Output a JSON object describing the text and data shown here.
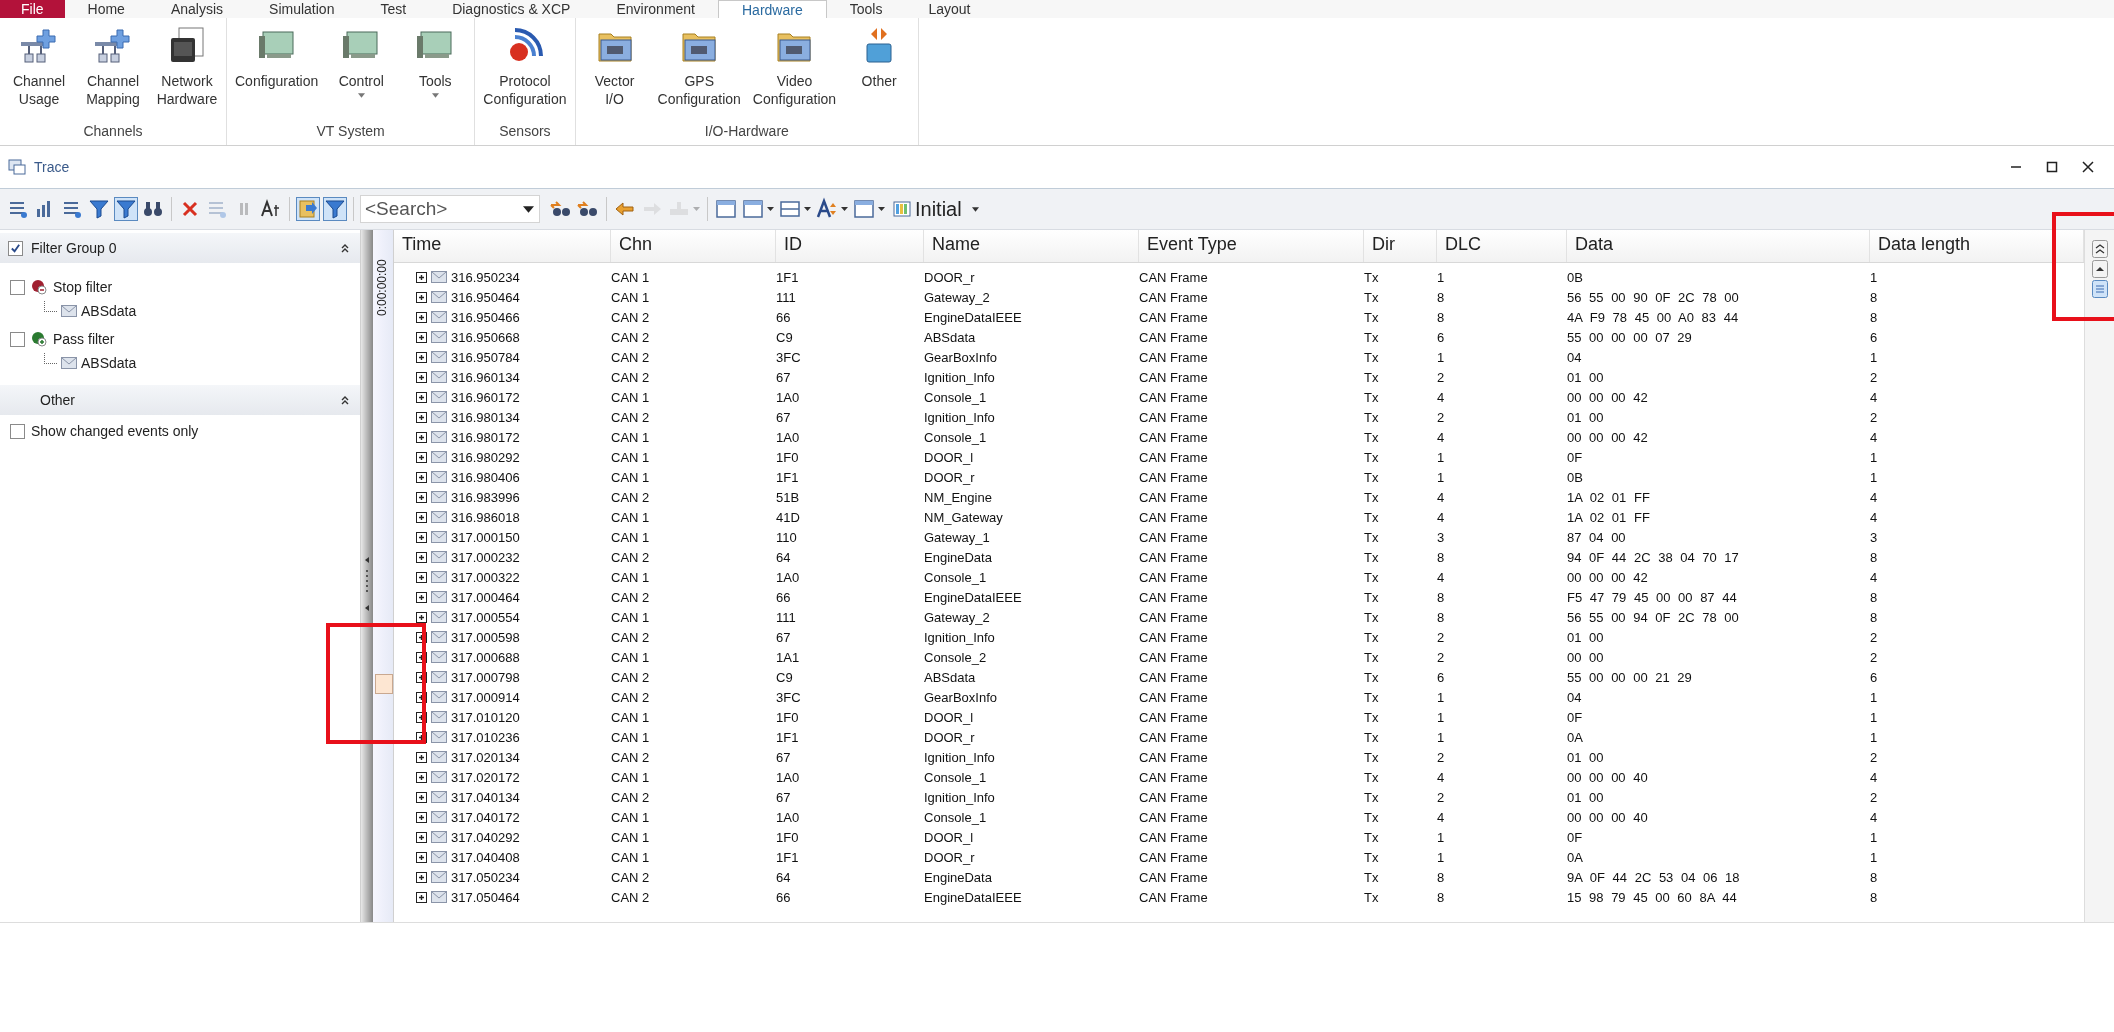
{
  "ribbon": {
    "tabs": [
      {
        "label": "File",
        "kind": "file",
        "selected": false
      },
      {
        "label": "Home",
        "kind": "tab",
        "selected": false
      },
      {
        "label": "Analysis",
        "kind": "tab",
        "selected": false
      },
      {
        "label": "Simulation",
        "kind": "tab",
        "selected": false
      },
      {
        "label": "Test",
        "kind": "tab",
        "selected": false
      },
      {
        "label": "Diagnostics & XCP",
        "kind": "tab",
        "selected": false
      },
      {
        "label": "Environment",
        "kind": "tab",
        "selected": false
      },
      {
        "label": "Hardware",
        "kind": "tab",
        "selected": true
      },
      {
        "label": "Tools",
        "kind": "tab",
        "selected": false
      },
      {
        "label": "Layout",
        "kind": "tab",
        "selected": false
      }
    ],
    "groups": [
      {
        "label": "Channels",
        "buttons": [
          {
            "lines": [
              "Channel",
              "Usage"
            ],
            "dropdown": false
          },
          {
            "lines": [
              "Channel",
              "Mapping"
            ],
            "dropdown": false
          },
          {
            "lines": [
              "Network",
              "Hardware"
            ],
            "dropdown": false
          }
        ]
      },
      {
        "label": "VT System",
        "buttons": [
          {
            "lines": [
              "Configuration"
            ],
            "dropdown": false
          },
          {
            "lines": [
              "Control"
            ],
            "dropdown": true
          },
          {
            "lines": [
              "Tools"
            ],
            "dropdown": true
          }
        ]
      },
      {
        "label": "Sensors",
        "buttons": [
          {
            "lines": [
              "Protocol",
              "Configuration"
            ],
            "dropdown": false
          }
        ]
      },
      {
        "label": "I/O-Hardware",
        "buttons": [
          {
            "lines": [
              "Vector",
              "I/O"
            ],
            "dropdown": false
          },
          {
            "lines": [
              "GPS",
              "Configuration"
            ],
            "dropdown": false
          },
          {
            "lines": [
              "Video",
              "Configuration"
            ],
            "dropdown": false
          },
          {
            "lines": [
              "Other"
            ],
            "dropdown": false
          }
        ]
      }
    ]
  },
  "trace": {
    "title": "Trace",
    "toolbar": {
      "tools_left": [
        {
          "pressed": false,
          "disabled": false
        },
        {
          "pressed": false,
          "disabled": false
        },
        {
          "pressed": false,
          "disabled": false
        },
        {
          "pressed": false,
          "disabled": false
        },
        {
          "pressed": true,
          "disabled": false
        },
        {
          "pressed": false,
          "disabled": false
        },
        {
          "pressed": false,
          "disabled": false
        },
        {
          "pressed": false,
          "disabled": true
        },
        {
          "pressed": false,
          "disabled": true
        },
        {
          "pressed": false,
          "disabled": false
        },
        {
          "pressed": true,
          "disabled": false
        },
        {
          "pressed": true,
          "disabled": false
        }
      ],
      "search": {
        "placeholder": "<Search>"
      },
      "tools_right": [
        {
          "disabled": false,
          "dropdown": false
        },
        {
          "disabled": false,
          "dropdown": false
        },
        {
          "disabled": false,
          "dropdown": false
        },
        {
          "disabled": true,
          "dropdown": false
        },
        {
          "disabled": true,
          "dropdown": true
        },
        {
          "disabled": false,
          "dropdown": false
        },
        {
          "disabled": false,
          "dropdown": true
        },
        {
          "disabled": false,
          "dropdown": true
        },
        {
          "disabled": false,
          "dropdown": true
        },
        {
          "disabled": false,
          "dropdown": true
        }
      ],
      "layout": {
        "value": "Initial"
      }
    },
    "filter_panel": {
      "group": {
        "label": "Filter Group 0",
        "checked": true,
        "expanded": true,
        "filters": [
          {
            "label": "Stop filter",
            "kind": "stop",
            "checked": false,
            "children": [
              {
                "label": "ABSdata"
              }
            ]
          },
          {
            "label": "Pass filter",
            "kind": "pass",
            "checked": false,
            "children": [
              {
                "label": "ABSdata"
              }
            ]
          }
        ]
      },
      "other": {
        "label": "Other",
        "expanded": true,
        "options": [
          {
            "label": "Show changed events only",
            "checked": false
          }
        ]
      }
    },
    "timeline": {
      "label": "0:00:00:00"
    },
    "table": {
      "columns": [
        "Time",
        "Chn",
        "ID",
        "Name",
        "Event Type",
        "Dir",
        "DLC",
        "Data",
        "Data length"
      ],
      "rows": [
        {
          "time": "316.950234",
          "chn": "CAN 1",
          "id": "1F1",
          "name": "DOOR_r",
          "event_type": "CAN Frame",
          "dir": "Tx",
          "dlc": "1",
          "data": "0B",
          "data_length": "1"
        },
        {
          "time": "316.950464",
          "chn": "CAN 1",
          "id": "111",
          "name": "Gateway_2",
          "event_type": "CAN Frame",
          "dir": "Tx",
          "dlc": "8",
          "data": "56 55 00 90 0F 2C 78 00",
          "data_length": "8"
        },
        {
          "time": "316.950466",
          "chn": "CAN 2",
          "id": "66",
          "name": "EngineDataIEEE",
          "event_type": "CAN Frame",
          "dir": "Tx",
          "dlc": "8",
          "data": "4A F9 78 45 00 A0 83 44",
          "data_length": "8"
        },
        {
          "time": "316.950668",
          "chn": "CAN 2",
          "id": "C9",
          "name": "ABSdata",
          "event_type": "CAN Frame",
          "dir": "Tx",
          "dlc": "6",
          "data": "55 00 00 00 07 29",
          "data_length": "6"
        },
        {
          "time": "316.950784",
          "chn": "CAN 2",
          "id": "3FC",
          "name": "GearBoxInfo",
          "event_type": "CAN Frame",
          "dir": "Tx",
          "dlc": "1",
          "data": "04",
          "data_length": "1"
        },
        {
          "time": "316.960134",
          "chn": "CAN 2",
          "id": "67",
          "name": "Ignition_Info",
          "event_type": "CAN Frame",
          "dir": "Tx",
          "dlc": "2",
          "data": "01 00",
          "data_length": "2"
        },
        {
          "time": "316.960172",
          "chn": "CAN 1",
          "id": "1A0",
          "name": "Console_1",
          "event_type": "CAN Frame",
          "dir": "Tx",
          "dlc": "4",
          "data": "00 00 00 42",
          "data_length": "4"
        },
        {
          "time": "316.980134",
          "chn": "CAN 2",
          "id": "67",
          "name": "Ignition_Info",
          "event_type": "CAN Frame",
          "dir": "Tx",
          "dlc": "2",
          "data": "01 00",
          "data_length": "2"
        },
        {
          "time": "316.980172",
          "chn": "CAN 1",
          "id": "1A0",
          "name": "Console_1",
          "event_type": "CAN Frame",
          "dir": "Tx",
          "dlc": "4",
          "data": "00 00 00 42",
          "data_length": "4"
        },
        {
          "time": "316.980292",
          "chn": "CAN 1",
          "id": "1F0",
          "name": "DOOR_l",
          "event_type": "CAN Frame",
          "dir": "Tx",
          "dlc": "1",
          "data": "0F",
          "data_length": "1"
        },
        {
          "time": "316.980406",
          "chn": "CAN 1",
          "id": "1F1",
          "name": "DOOR_r",
          "event_type": "CAN Frame",
          "dir": "Tx",
          "dlc": "1",
          "data": "0B",
          "data_length": "1"
        },
        {
          "time": "316.983996",
          "chn": "CAN 2",
          "id": "51B",
          "name": "NM_Engine",
          "event_type": "CAN Frame",
          "dir": "Tx",
          "dlc": "4",
          "data": "1A 02 01 FF",
          "data_length": "4"
        },
        {
          "time": "316.986018",
          "chn": "CAN 1",
          "id": "41D",
          "name": "NM_Gateway",
          "event_type": "CAN Frame",
          "dir": "Tx",
          "dlc": "4",
          "data": "1A 02 01 FF",
          "data_length": "4"
        },
        {
          "time": "317.000150",
          "chn": "CAN 1",
          "id": "110",
          "name": "Gateway_1",
          "event_type": "CAN Frame",
          "dir": "Tx",
          "dlc": "3",
          "data": "87 04 00",
          "data_length": "3"
        },
        {
          "time": "317.000232",
          "chn": "CAN 2",
          "id": "64",
          "name": "EngineData",
          "event_type": "CAN Frame",
          "dir": "Tx",
          "dlc": "8",
          "data": "94 0F 44 2C 38 04 70 17",
          "data_length": "8"
        },
        {
          "time": "317.000322",
          "chn": "CAN 1",
          "id": "1A0",
          "name": "Console_1",
          "event_type": "CAN Frame",
          "dir": "Tx",
          "dlc": "4",
          "data": "00 00 00 42",
          "data_length": "4"
        },
        {
          "time": "317.000464",
          "chn": "CAN 2",
          "id": "66",
          "name": "EngineDataIEEE",
          "event_type": "CAN Frame",
          "dir": "Tx",
          "dlc": "8",
          "data": "F5 47 79 45 00 00 87 44",
          "data_length": "8"
        },
        {
          "time": "317.000554",
          "chn": "CAN 1",
          "id": "111",
          "name": "Gateway_2",
          "event_type": "CAN Frame",
          "dir": "Tx",
          "dlc": "8",
          "data": "56 55 00 94 0F 2C 78 00",
          "data_length": "8"
        },
        {
          "time": "317.000598",
          "chn": "CAN 2",
          "id": "67",
          "name": "Ignition_Info",
          "event_type": "CAN Frame",
          "dir": "Tx",
          "dlc": "2",
          "data": "01 00",
          "data_length": "2"
        },
        {
          "time": "317.000688",
          "chn": "CAN 1",
          "id": "1A1",
          "name": "Console_2",
          "event_type": "CAN Frame",
          "dir": "Tx",
          "dlc": "2",
          "data": "00 00",
          "data_length": "2"
        },
        {
          "time": "317.000798",
          "chn": "CAN 2",
          "id": "C9",
          "name": "ABSdata",
          "event_type": "CAN Frame",
          "dir": "Tx",
          "dlc": "6",
          "data": "55 00 00 00 21 29",
          "data_length": "6"
        },
        {
          "time": "317.000914",
          "chn": "CAN 2",
          "id": "3FC",
          "name": "GearBoxInfo",
          "event_type": "CAN Frame",
          "dir": "Tx",
          "dlc": "1",
          "data": "04",
          "data_length": "1"
        },
        {
          "time": "317.010120",
          "chn": "CAN 1",
          "id": "1F0",
          "name": "DOOR_l",
          "event_type": "CAN Frame",
          "dir": "Tx",
          "dlc": "1",
          "data": "0F",
          "data_length": "1"
        },
        {
          "time": "317.010236",
          "chn": "CAN 1",
          "id": "1F1",
          "name": "DOOR_r",
          "event_type": "CAN Frame",
          "dir": "Tx",
          "dlc": "1",
          "data": "0A",
          "data_length": "1"
        },
        {
          "time": "317.020134",
          "chn": "CAN 2",
          "id": "67",
          "name": "Ignition_Info",
          "event_type": "CAN Frame",
          "dir": "Tx",
          "dlc": "2",
          "data": "01 00",
          "data_length": "2"
        },
        {
          "time": "317.020172",
          "chn": "CAN 1",
          "id": "1A0",
          "name": "Console_1",
          "event_type": "CAN Frame",
          "dir": "Tx",
          "dlc": "4",
          "data": "00 00 00 40",
          "data_length": "4"
        },
        {
          "time": "317.040134",
          "chn": "CAN 2",
          "id": "67",
          "name": "Ignition_Info",
          "event_type": "CAN Frame",
          "dir": "Tx",
          "dlc": "2",
          "data": "01 00",
          "data_length": "2"
        },
        {
          "time": "317.040172",
          "chn": "CAN 1",
          "id": "1A0",
          "name": "Console_1",
          "event_type": "CAN Frame",
          "dir": "Tx",
          "dlc": "4",
          "data": "00 00 00 40",
          "data_length": "4"
        },
        {
          "time": "317.040292",
          "chn": "CAN 1",
          "id": "1F0",
          "name": "DOOR_l",
          "event_type": "CAN Frame",
          "dir": "Tx",
          "dlc": "1",
          "data": "0F",
          "data_length": "1"
        },
        {
          "time": "317.040408",
          "chn": "CAN 1",
          "id": "1F1",
          "name": "DOOR_r",
          "event_type": "CAN Frame",
          "dir": "Tx",
          "dlc": "1",
          "data": "0A",
          "data_length": "1"
        },
        {
          "time": "317.050234",
          "chn": "CAN 2",
          "id": "64",
          "name": "EngineData",
          "event_type": "CAN Frame",
          "dir": "Tx",
          "dlc": "8",
          "data": "9A 0F 44 2C 53 04 06 18",
          "data_length": "8"
        },
        {
          "time": "317.050464",
          "chn": "CAN 2",
          "id": "66",
          "name": "EngineDataIEEE",
          "event_type": "CAN Frame",
          "dir": "Tx",
          "dlc": "8",
          "data": "15 98 79 45 00 60 8A 44",
          "data_length": "8"
        }
      ]
    }
  }
}
